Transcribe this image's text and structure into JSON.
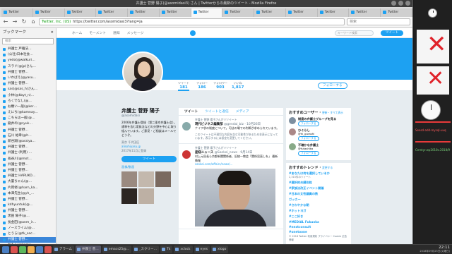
{
  "window": {
    "title": "弁護士 菅野 陽子(@asomidasi3) さん | Twitterからの最新のツイート - Mozilla Firefox"
  },
  "tabs": [
    "Twitter",
    "Twitter",
    "Twitter",
    "Twitter",
    "Twitter",
    "Twitter",
    "Twitter",
    "Twitter",
    "Twitter",
    "Twitter",
    "Twitter",
    "Twitter",
    "Twitter"
  ],
  "navbar": {
    "back": "←",
    "forward": "→",
    "reload": "↻",
    "home": "⌂",
    "secure_label": "Twitter, Inc. (US)",
    "url": "https://twitter.com/asomidasi3?lang=ja",
    "search_placeholder": "検索"
  },
  "sidebar": {
    "title": "ブックマーク",
    "close": "×",
    "search_placeholder": "検索",
    "items": [
      "弁護士 戸籍法…",
      "(公社)日本社会…",
      "yedo(@walkuri…",
      "スラド(@jp)さん…",
      "弁護士 菅野…",
      "いわばえ(@yasu…",
      "弁護士 菅野…",
      "sas(@sas_h)さん…",
      "小林(@kbyt_n)…",
      "ろくでなし(@…",
      "お願い一般(@ker…",
      "えにち(@kamnay…",
      "こちらは一般(@…",
      "龍井の(@ryuk…",
      "弁護士 菅野…",
      "石川 裕幸(@h…",
      "新谷翔(@araiya…",
      "弁護士 菅野…",
      "弁護士 (利用) …",
      "長谷川(@mot…",
      "弁護士 菅野…",
      "弁護士 菅野…",
      "弁護士 HARUKO…",
      "大輩ちゃん(@…",
      "片岡修(@harn_ka…",
      "本澤先生(@yh_…",
      "弁護士 菅野…",
      "kdhyuntuk(@…",
      "弁護士 菅野…",
      "黒田 陽子(@…",
      "長金田(@anm_ir…",
      "ノースライム(@…",
      "とうら(@tk_sec…",
      "弁護士 菅野…",
      "かもん(@kamo…",
      "くまえう(@kum…",
      "弁護士 小松…"
    ],
    "selected_index": 33
  },
  "twitter": {
    "nav": {
      "home": "ホーム",
      "moments": "モーメント",
      "notifications": "通知",
      "messages": "メッセージ",
      "search_placeholder": "キーワード検索",
      "tweet_button": "ツイート"
    },
    "stats": [
      {
        "label": "ツイート",
        "value": "181"
      },
      {
        "label": "フォロー",
        "value": "186"
      },
      {
        "label": "フォロワー",
        "value": "903"
      },
      {
        "label": "いいね",
        "value": "1,817"
      }
    ],
    "follow_button": "フォローする",
    "profile": {
      "name": "弁護士 菅野 陽子",
      "handle": "@asomidasi",
      "bio": "2006年弁護士登録（第二東京弁護士会）。通称を含む家族法などの分野を中心に取り組んでいます。ご意見・ご相談はメールでどうぞ。",
      "location": "東京 千代田区",
      "link": "alisohiyasu.jp",
      "joined": "2017年11月に登録",
      "tweet_to": "ツイート",
      "media": "画像/動画"
    },
    "timeline_tabs": [
      "ツイート",
      "ツイートと返信",
      "メディア"
    ],
    "tweets": [
      {
        "context": "弁護士 菅野 陽子さんがリツイート",
        "author": "現代ビジネス編集部",
        "handle": "@gendai_biz · 10月26日",
        "text": "ナイフ状の制度について。司法の場での判断が求められています。",
        "note": "このツイートは不適切な内容を含む可能性があるため非表示になっています。表示するには設定を変更してください。"
      },
      {
        "context": "弁護士 菅野 陽子さんがリツイート",
        "author": "産経ニュース",
        "handle": "@Sankei_news · 9月14日",
        "text": "村上元局長ら京都新聞関係者、旧統一教会「関係見直しを」 最新情報",
        "link": "sankei.com/affairs/news/…"
      }
    ],
    "right": {
      "suggestions_title": "おすすめユーザー",
      "suggestions_action": "更新・すべて表示",
      "suggestions": [
        {
          "name": "制度の弁護士グループを見る",
          "handle": "",
          "button": "フォローする"
        },
        {
          "name": "ひぐらし",
          "handle": "@hi_gurashi",
          "button": "フォローする"
        },
        {
          "name": "不確かな弁護士",
          "handle": "@futashika",
          "button": "フォローする"
        }
      ],
      "trends_title": "おすすめトレンド",
      "trends_action": "変更する",
      "trends": [
        {
          "tag": "#あなたは何を選択しているか",
          "sub": "2,315件のツイート"
        },
        {
          "tag": "#選択的夫婦別姓",
          "sub": ""
        },
        {
          "tag": "#家族法改正イベント開催",
          "sub": ""
        },
        {
          "tag": "#日本の女性議員の数",
          "sub": ""
        },
        {
          "tag": "ガッカー",
          "sub": ""
        },
        {
          "tag": "#さわやかな朝",
          "sub": ""
        },
        {
          "tag": "#ホットヨガ",
          "sub": ""
        },
        {
          "tag": "#ここ好き",
          "sub": ""
        },
        {
          "tag": "#MEDIAL Fukuoka",
          "sub": ""
        },
        {
          "tag": "#nextconsult",
          "sub": ""
        },
        {
          "tag": "#onetoone",
          "sub": ""
        }
      ],
      "footer": "© 2018 Twitter 利用規約 プライバシー Cookie 広告情報"
    }
  },
  "taskbar": {
    "tasks": [
      "アラーム",
      "弁護士 菅…",
      "emacs25@…",
      "_スクリー…",
      "Tk",
      "xclock",
      "eyes",
      "xlogo"
    ],
    "active_index": 1,
    "time": "22:11",
    "date": "2018年09月25日(火曜日)"
  },
  "desktop": {
    "red_text": "Seesd-add-mysql-uuq",
    "green_text": "Cemtyr.wp2018v.2018/9"
  }
}
